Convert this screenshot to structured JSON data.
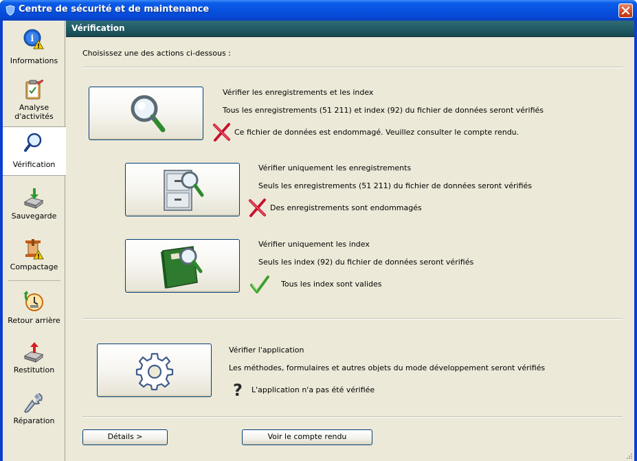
{
  "window": {
    "title": "Centre de sécurité et de maintenance"
  },
  "sidebar": {
    "items": [
      {
        "label": "Informations",
        "icon": "info-warning-icon"
      },
      {
        "label": "Analyse d'activités",
        "icon": "clipboard-analysis-icon"
      },
      {
        "label": "Vérification",
        "icon": "magnifier-icon",
        "active": true
      },
      {
        "label": "Sauvegarde",
        "icon": "backup-drive-icon"
      },
      {
        "label": "Compactage",
        "icon": "compact-warning-icon"
      },
      {
        "label": "Retour arrière",
        "icon": "clock-rollback-icon"
      },
      {
        "label": "Restitution",
        "icon": "restore-drive-icon"
      },
      {
        "label": "Réparation",
        "icon": "wrench-icon"
      }
    ]
  },
  "main": {
    "header": "Vérification",
    "prompt": "Choisissez une des actions ci-dessous :",
    "actions": [
      {
        "title": "Vérifier les enregistrements et les index",
        "description": "Tous les enregistrements (51 211) et index (92) du fichier de données seront vérifiés",
        "status": "Ce fichier de données est endommagé. Veuillez consulter le compte rendu.",
        "status_icon": "red-x-icon"
      },
      {
        "title": "Vérifier uniquement les enregistrements",
        "description": "Seuls les enregistrements (51 211) du fichier de données seront vérifiés",
        "status": "Des enregistrements sont endommagés",
        "status_icon": "red-x-icon"
      },
      {
        "title": "Vérifier uniquement les index",
        "description": "Seuls les index (92) du fichier de données seront vérifiés",
        "status": "Tous les index sont valides",
        "status_icon": "green-check-icon"
      },
      {
        "title": "Vérifier l'application",
        "description": "Les méthodes, formulaires et autres objets du mode développement seront vérifiés",
        "status": "L'application n'a pas été vérifiée",
        "status_icon": "question-mark-icon"
      }
    ],
    "buttons": {
      "details": "Détails >",
      "report": "Voir le compte rendu"
    }
  },
  "colors": {
    "title_bar": "#0752e0",
    "section_header": "#215b66",
    "client_bg": "#ece9d8",
    "error": "#c8102e",
    "ok": "#3da12b"
  }
}
